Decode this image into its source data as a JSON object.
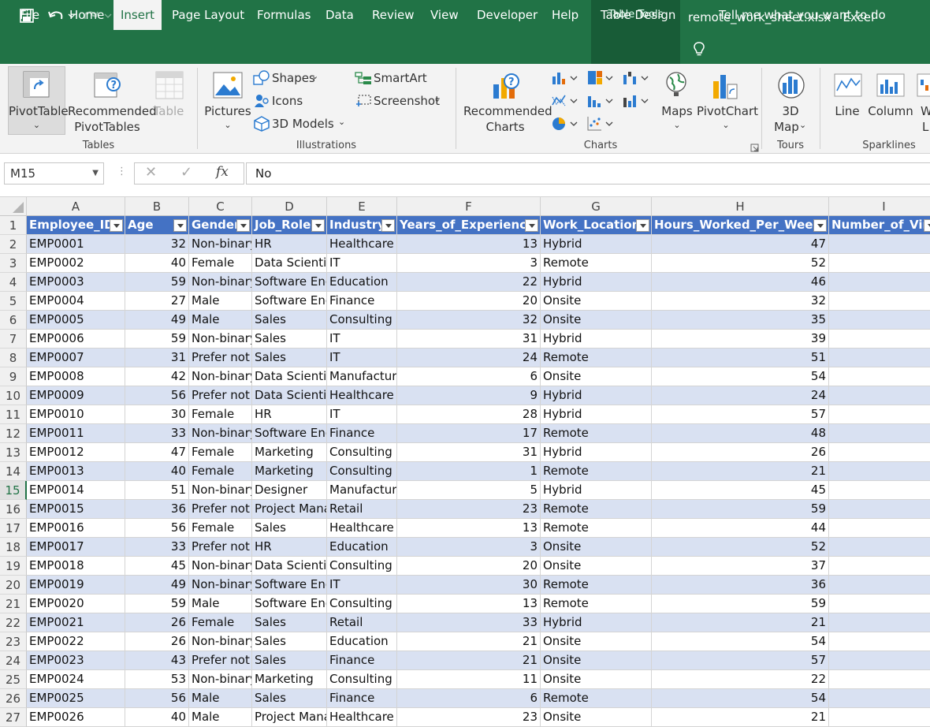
{
  "titlebar": {
    "table_tools": "Table Tools",
    "file_title": "remote_work_sheet.xlsx  -  Excel"
  },
  "tabs": [
    {
      "label": "File",
      "name": "tab-file"
    },
    {
      "label": "Home",
      "name": "tab-home"
    },
    {
      "label": "Insert",
      "name": "tab-insert",
      "active": true
    },
    {
      "label": "Page Layout",
      "name": "tab-page-layout"
    },
    {
      "label": "Formulas",
      "name": "tab-formulas"
    },
    {
      "label": "Data",
      "name": "tab-data"
    },
    {
      "label": "Review",
      "name": "tab-review"
    },
    {
      "label": "View",
      "name": "tab-view"
    },
    {
      "label": "Developer",
      "name": "tab-developer"
    },
    {
      "label": "Help",
      "name": "tab-help"
    },
    {
      "label": "Table Design",
      "name": "tab-table-design"
    }
  ],
  "tell_me": "Tell me what you want to do",
  "ribbon": {
    "pivottable": "PivotTable",
    "rec_pivot_1": "Recommended",
    "rec_pivot_2": "PivotTables",
    "table": "Table",
    "tables_group": "Tables",
    "pictures": "Pictures",
    "shapes": "Shapes",
    "icons": "Icons",
    "models": "3D Models",
    "smartart": "SmartArt",
    "screenshot": "Screenshot",
    "illustrations_group": "Illustrations",
    "rec_charts_1": "Recommended",
    "rec_charts_2": "Charts",
    "maps": "Maps",
    "pivotchart": "PivotChart",
    "charts_group": "Charts",
    "map3d_1": "3D",
    "map3d_2": "Map",
    "tours_group": "Tours",
    "line": "Line",
    "column": "Column",
    "winloss_1": "W",
    "winloss_2": "L",
    "sparklines_group": "Sparklines"
  },
  "formula_bar": {
    "namebox": "M15",
    "fx": "fx",
    "value": "No"
  },
  "columns": [
    "A",
    "B",
    "C",
    "D",
    "E",
    "F",
    "G",
    "H",
    "I"
  ],
  "headers": [
    "Employee_ID",
    "Age",
    "Gender",
    "Job_Role",
    "Industry",
    "Years_of_Experience",
    "Work_Location",
    "Hours_Worked_Per_Week",
    "Number_of_Virtu"
  ],
  "rows": [
    [
      "EMP0001",
      "32",
      "Non-binary",
      "HR",
      "Healthcare",
      "13",
      "Hybrid",
      "47"
    ],
    [
      "EMP0002",
      "40",
      "Female",
      "Data Scientist",
      "IT",
      "3",
      "Remote",
      "52"
    ],
    [
      "EMP0003",
      "59",
      "Non-binary",
      "Software Engineer",
      "Education",
      "22",
      "Hybrid",
      "46"
    ],
    [
      "EMP0004",
      "27",
      "Male",
      "Software Engineer",
      "Finance",
      "20",
      "Onsite",
      "32"
    ],
    [
      "EMP0005",
      "49",
      "Male",
      "Sales",
      "Consulting",
      "32",
      "Onsite",
      "35"
    ],
    [
      "EMP0006",
      "59",
      "Non-binary",
      "Sales",
      "IT",
      "31",
      "Hybrid",
      "39"
    ],
    [
      "EMP0007",
      "31",
      "Prefer not to say",
      "Sales",
      "IT",
      "24",
      "Remote",
      "51"
    ],
    [
      "EMP0008",
      "42",
      "Non-binary",
      "Data Scientist",
      "Manufacturing",
      "6",
      "Onsite",
      "54"
    ],
    [
      "EMP0009",
      "56",
      "Prefer not to say",
      "Data Scientist",
      "Healthcare",
      "9",
      "Hybrid",
      "24"
    ],
    [
      "EMP0010",
      "30",
      "Female",
      "HR",
      "IT",
      "28",
      "Hybrid",
      "57"
    ],
    [
      "EMP0011",
      "33",
      "Non-binary",
      "Software Engineer",
      "Finance",
      "17",
      "Remote",
      "48"
    ],
    [
      "EMP0012",
      "47",
      "Female",
      "Marketing",
      "Consulting",
      "31",
      "Hybrid",
      "26"
    ],
    [
      "EMP0013",
      "40",
      "Female",
      "Marketing",
      "Consulting",
      "1",
      "Remote",
      "21"
    ],
    [
      "EMP0014",
      "51",
      "Non-binary",
      "Designer",
      "Manufacturing",
      "5",
      "Hybrid",
      "45"
    ],
    [
      "EMP0015",
      "36",
      "Prefer not to say",
      "Project Manager",
      "Retail",
      "23",
      "Remote",
      "59"
    ],
    [
      "EMP0016",
      "56",
      "Female",
      "Sales",
      "Healthcare",
      "13",
      "Remote",
      "44"
    ],
    [
      "EMP0017",
      "33",
      "Prefer not to say",
      "HR",
      "Education",
      "3",
      "Onsite",
      "52"
    ],
    [
      "EMP0018",
      "45",
      "Non-binary",
      "Data Scientist",
      "Consulting",
      "20",
      "Onsite",
      "37"
    ],
    [
      "EMP0019",
      "49",
      "Non-binary",
      "Software Engineer",
      "IT",
      "30",
      "Remote",
      "36"
    ],
    [
      "EMP0020",
      "59",
      "Male",
      "Software Engineer",
      "Consulting",
      "13",
      "Remote",
      "59"
    ],
    [
      "EMP0021",
      "26",
      "Female",
      "Sales",
      "Retail",
      "33",
      "Hybrid",
      "21"
    ],
    [
      "EMP0022",
      "26",
      "Non-binary",
      "Sales",
      "Education",
      "21",
      "Onsite",
      "54"
    ],
    [
      "EMP0023",
      "43",
      "Prefer not to say",
      "Sales",
      "Finance",
      "21",
      "Onsite",
      "57"
    ],
    [
      "EMP0024",
      "53",
      "Non-binary",
      "Marketing",
      "Consulting",
      "11",
      "Onsite",
      "22"
    ],
    [
      "EMP0025",
      "56",
      "Male",
      "Sales",
      "Finance",
      "6",
      "Remote",
      "54"
    ],
    [
      "EMP0026",
      "40",
      "Male",
      "Project Manager",
      "Healthcare",
      "23",
      "Onsite",
      "21"
    ]
  ],
  "colors": {
    "excel_green": "#217346",
    "table_header": "#4472c4",
    "band": "#d9e1f2"
  }
}
